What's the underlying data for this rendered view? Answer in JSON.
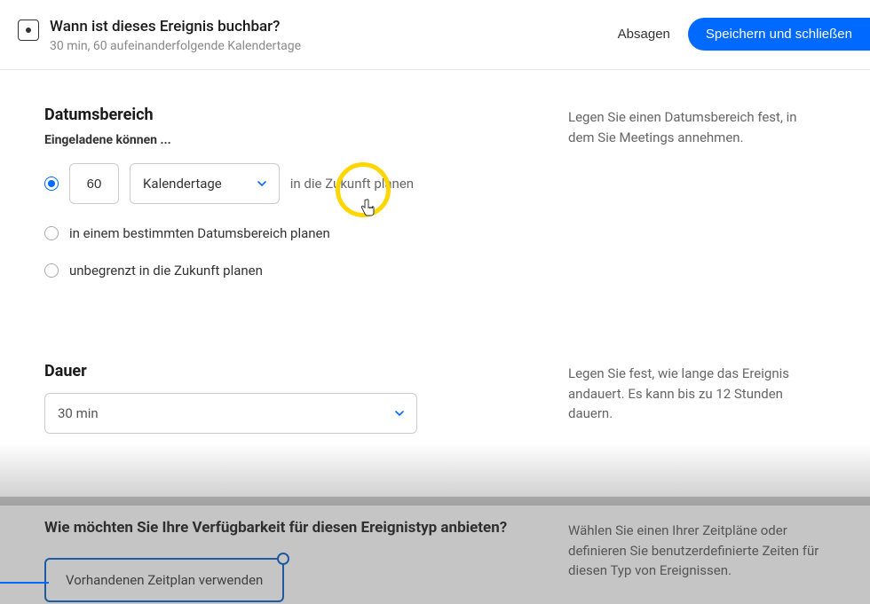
{
  "header": {
    "title": "Wann ist dieses Ereignis buchbar?",
    "subtitle": "30 min, 60 aufeinanderfolgende Kalendertage",
    "cancel_label": "Absagen",
    "save_label": "Speichern und schließen"
  },
  "date_range": {
    "title": "Datumsbereich",
    "subtitle": "Eingeladene können ...",
    "help": "Legen Sie einen Datumsbereich fest, in dem Sie Meetings annehmen.",
    "options": {
      "future": {
        "value": "60",
        "unit": "Kalendertage",
        "suffix": "in die Zukunft planen"
      },
      "specific": "in einem bestimmten Datumsbereich planen",
      "unlimited": "unbegrenzt in die Zukunft planen"
    }
  },
  "duration": {
    "title": "Dauer",
    "value": "30 min",
    "help": "Legen Sie fest, wie lange das Ereignis andauert. Es kann bis zu 12 Stunden dauern."
  },
  "availability": {
    "title": "Wie möchten Sie Ihre Verfügbarkeit für diesen Ereignistyp anbieten?",
    "tab_label": "Vorhandenen Zeitplan verwenden",
    "help": "Wählen Sie einen Ihrer Zeitpläne oder definieren Sie benutzerdefinierte Zeiten für diesen Typ von Ereignissen."
  }
}
